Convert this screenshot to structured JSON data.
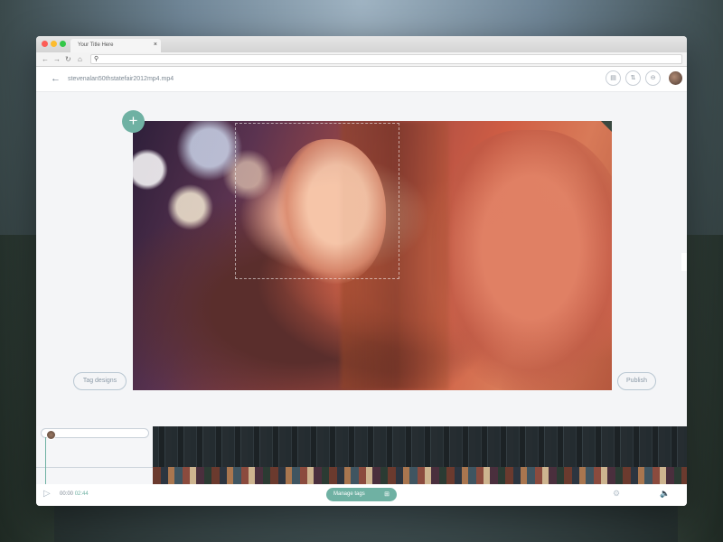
{
  "browser": {
    "tab_title": "Your Title Here",
    "tab_close": "×"
  },
  "header": {
    "back_icon": "←",
    "filename": "stevenalan50thstatefair2012mp4.mp4"
  },
  "stage": {
    "add_label": "+",
    "tag_designs_label": "Tag designs",
    "publish_label": "Publish"
  },
  "controls": {
    "play_icon": "▷",
    "current_time": "00:00",
    "duration": "02:44",
    "manage_tags_label": "Manage tags",
    "manage_tags_icon": "⊞"
  },
  "icons": {
    "back": "arrow-left-icon",
    "stats": "bar-chart-icon",
    "sort": "sort-icon",
    "embed": "embed-icon",
    "avatar": "user-avatar",
    "play": "play-icon",
    "settings": "settings-icon",
    "volume": "volume-icon"
  },
  "colors": {
    "accent": "#6fb1a3",
    "pill_border": "#b9c7d2",
    "timeline_bg": "#1f2528"
  }
}
